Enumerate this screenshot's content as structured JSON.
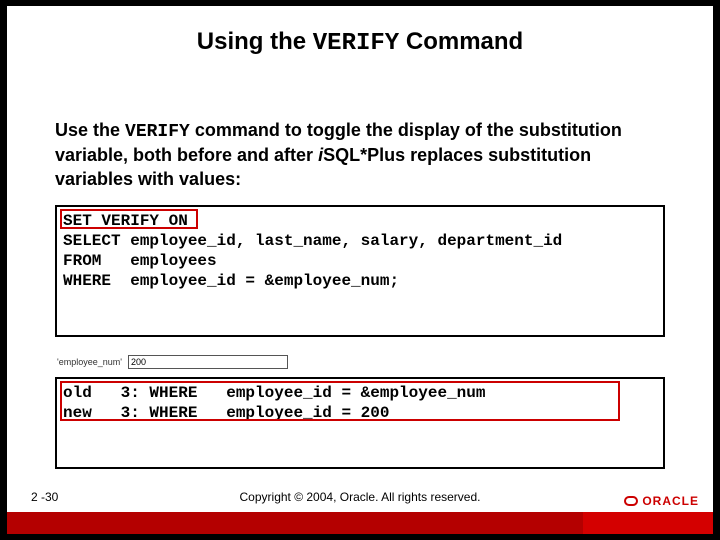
{
  "title": {
    "pre": "Using the ",
    "mono": "VERIFY",
    "post": " Command"
  },
  "paragraph": {
    "pre": "Use the ",
    "mono": "VERIFY",
    "mid": " command to toggle the display of the substitution variable, both before and after ",
    "ital": "i",
    "post": "SQL*Plus replaces substitution variables with values:"
  },
  "code1": {
    "line1": "SET VERIFY ON",
    "line2": "SELECT employee_id, last_name, salary, department_id",
    "line3": "FROM   employees",
    "line4": "WHERE  employee_id = &employee_num;"
  },
  "prompt": {
    "label": "'employee_num'",
    "value": "200"
  },
  "code2": {
    "line1": "old   3: WHERE   employee_id = &employee_num",
    "line2": "new   3: WHERE   employee_id = 200"
  },
  "footer": {
    "pagenum": "2 -30",
    "copyright": "Copyright © 2004, Oracle. All rights reserved.",
    "logo_text": "ORACLE"
  }
}
